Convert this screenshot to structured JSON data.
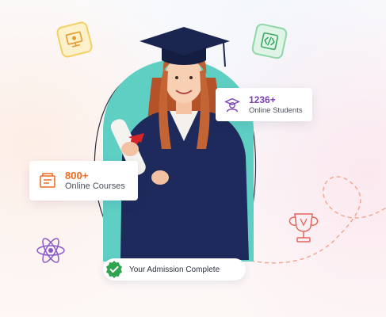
{
  "students_card": {
    "count": "1236+",
    "label": "Online Students",
    "icon": "graduate-icon"
  },
  "courses_card": {
    "count": "800+",
    "label": "Online Courses",
    "icon": "course-book-icon"
  },
  "admission_badge": {
    "label": "Your Admission Complete",
    "icon": "check-badge-icon"
  },
  "colors": {
    "teal": "#5fcfc4",
    "orange": "#ef6a1e",
    "purple": "#7b3fb2",
    "gown": "#1e2a5c",
    "check": "#2ea44f"
  }
}
